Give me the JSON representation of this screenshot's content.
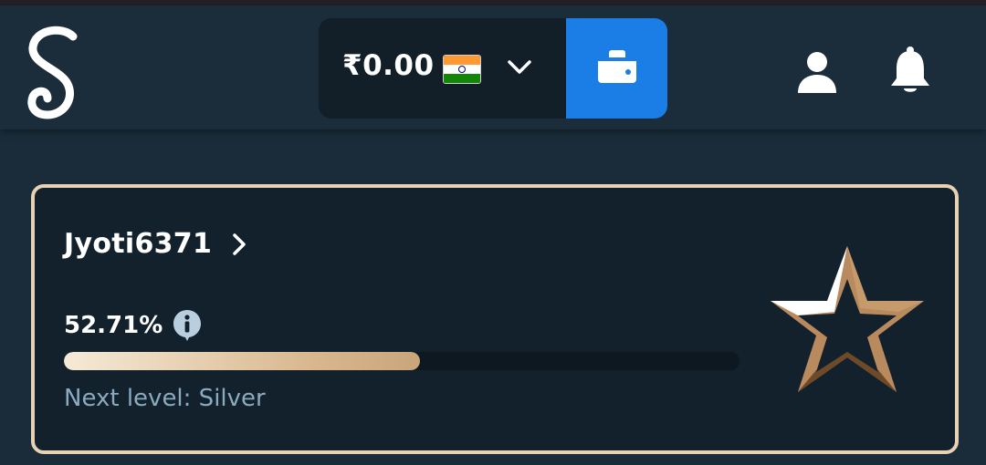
{
  "header": {
    "balance": "₹0.00",
    "currency_flag": "india-flag-icon",
    "accent_color": "#1a7ee6"
  },
  "vip": {
    "username": "Jyoti6371",
    "progress_label": "52.71%",
    "progress": 52.71,
    "next_level": "Next level: Silver",
    "border_color": "#e8d2b4"
  }
}
